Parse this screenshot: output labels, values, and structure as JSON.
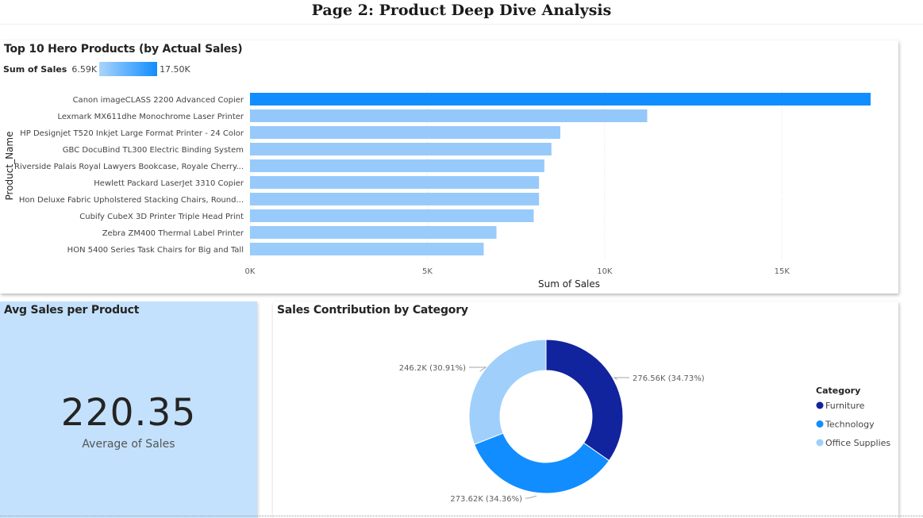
{
  "page": {
    "title": "Page 2: Product Deep Dive Analysis"
  },
  "bar_card": {
    "title": "Top 10 Hero Products (by Actual Sales)",
    "legend_label": "Sum of Sales",
    "legend_min": "6.59K",
    "legend_max": "17.50K"
  },
  "kpi_card": {
    "title": "Avg Sales per Product",
    "value": "220.35",
    "label": "Average of Sales"
  },
  "donut_card": {
    "title": "Sales Contribution by Category"
  },
  "colors": {
    "bar_max": "#118dff",
    "bar_min": "#99cbfb",
    "furniture": "#12239e",
    "technology": "#118dff",
    "office_supplies": "#a0cffb",
    "kpi_bg": "#c3e1fc"
  },
  "chart_data": [
    {
      "type": "bar",
      "orientation": "horizontal",
      "title": "Top 10 Hero Products (by Actual Sales)",
      "xlabel": "Sum of Sales",
      "ylabel": "Product_Name",
      "xlim": [
        0,
        17500
      ],
      "xticks": [
        0,
        5000,
        10000,
        15000
      ],
      "xtick_labels": [
        "0K",
        "5K",
        "10K",
        "15K"
      ],
      "grid": true,
      "legend": "gradient, top-left",
      "categories": [
        "Canon imageCLASS 2200 Advanced Copier",
        "Lexmark MX611dhe Monochrome Laser Printer",
        "HP Designjet T520 Inkjet Large Format Printer - 24 Color",
        "GBC DocuBind TL300 Electric Binding System",
        "Riverside Palais Royal Lawyers Bookcase, Royale Cherry...",
        "Hewlett Packard LaserJet 3310 Copier",
        "Hon Deluxe Fabric Upholstered Stacking Chairs, Round...",
        "Cubify CubeX 3D Printer Triple Head Print",
        "Zebra ZM400 Thermal Label Printer",
        "HON 5400 Series Task Chairs for Big and Tall"
      ],
      "values": [
        17500,
        11200,
        8750,
        8500,
        8300,
        8150,
        8150,
        8000,
        6950,
        6590
      ]
    },
    {
      "type": "pie",
      "variant": "donut",
      "title": "Sales Contribution by Category",
      "legend_title": "Category",
      "legend": "right",
      "labels": [
        "Furniture",
        "Technology",
        "Office Supplies"
      ],
      "values": [
        276560,
        273620,
        246200
      ],
      "data_labels": [
        "276.56K (34.73%)",
        "273.62K (34.36%)",
        "246.2K (30.91%)"
      ]
    }
  ]
}
